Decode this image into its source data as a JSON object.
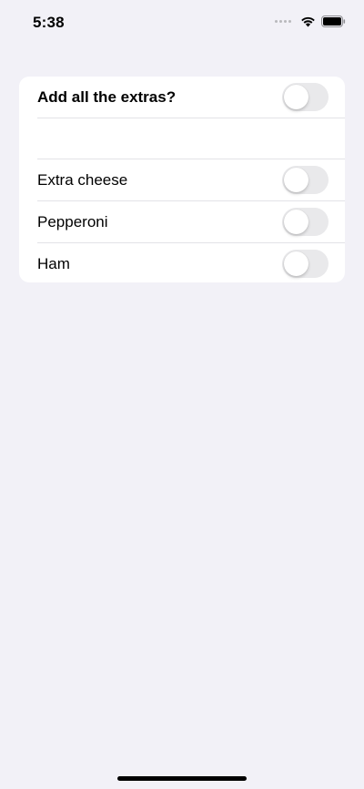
{
  "status_bar": {
    "time": "5:38"
  },
  "form": {
    "master_toggle": {
      "label": "Add all the extras?",
      "on": false
    },
    "items": [
      {
        "label": "Extra cheese",
        "on": false
      },
      {
        "label": "Pepperoni",
        "on": false
      },
      {
        "label": "Ham",
        "on": false
      }
    ]
  },
  "colors": {
    "background": "#f2f1f7",
    "card": "#ffffff",
    "toggle_off": "#e9e9eb",
    "divider": "#e3e3e7"
  }
}
